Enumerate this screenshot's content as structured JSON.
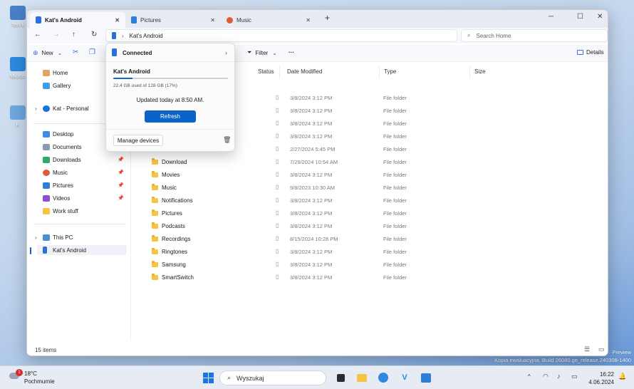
{
  "desktop": {
    "icons": [
      {
        "label": "Ten k"
      },
      {
        "label": "Micros"
      },
      {
        "label": "K"
      }
    ],
    "watermark": {
      "line1": "Preview",
      "line2": "Kopia ewaluacyjna. Build 26080.ge_release.240308-1400"
    }
  },
  "tabs": [
    {
      "label": "Kat's Android",
      "active": true
    },
    {
      "label": "Pictures",
      "active": false
    },
    {
      "label": "Music",
      "active": false
    }
  ],
  "window_controls": {
    "minimize": "─",
    "maximize": "☐",
    "close": "✕"
  },
  "address": {
    "crumb": "Kat's Android",
    "search_placeholder": "Search Home"
  },
  "command_bar": {
    "new_label": "New",
    "filter_label": "Filter",
    "more_label": "···",
    "details_label": "Details"
  },
  "sidebar": {
    "items": [
      {
        "label": "Home"
      },
      {
        "label": "Gallery"
      },
      {
        "label": "Kat - Personal"
      },
      {
        "label": "Desktop"
      },
      {
        "label": "Documents"
      },
      {
        "label": "Downloads"
      },
      {
        "label": "Music"
      },
      {
        "label": "Pictures"
      },
      {
        "label": "Videos"
      },
      {
        "label": "Work stuff"
      },
      {
        "label": "This PC"
      },
      {
        "label": "Kat's Android"
      }
    ]
  },
  "columns": {
    "status": "Status",
    "date": "Date Modified",
    "type": "Type",
    "size": "Size"
  },
  "rows": [
    {
      "name": "",
      "date": "3/8/2024 3:12 PM",
      "type": "File folder"
    },
    {
      "name": "",
      "date": "3/8/2024 3:12 PM",
      "type": "File folder"
    },
    {
      "name": "",
      "date": "3/8/2024 3:12 PM",
      "type": "File folder"
    },
    {
      "name": "",
      "date": "3/8/2024 3:12 PM",
      "type": "File folder"
    },
    {
      "name": "",
      "date": "2/27/2024 5:45 PM",
      "type": "File folder"
    },
    {
      "name": "Download",
      "date": "7/29/2024 10:54 AM",
      "type": "File folder"
    },
    {
      "name": "Movies",
      "date": "3/8/2024 3:12 PM",
      "type": "File folder"
    },
    {
      "name": "Music",
      "date": "9/8/2023 10:30 AM",
      "type": "File folder"
    },
    {
      "name": "Notifications",
      "date": "3/8/2024 3:12 PM",
      "type": "File folder"
    },
    {
      "name": "Pictures",
      "date": "3/8/2024 3:12 PM",
      "type": "File folder"
    },
    {
      "name": "Podcasts",
      "date": "3/8/2024 3:12 PM",
      "type": "File folder"
    },
    {
      "name": "Recordings",
      "date": "8/15/2024 10:28 PM",
      "type": "File folder"
    },
    {
      "name": "Ringtones",
      "date": "3/8/2024 3:12 PM",
      "type": "File folder"
    },
    {
      "name": "Samsung",
      "date": "3/8/2024 3:12 PM",
      "type": "File folder"
    },
    {
      "name": "SmartSwitch",
      "date": "3/8/2024 3:12 PM",
      "type": "File folder"
    }
  ],
  "status_bar": {
    "count": "15 items"
  },
  "flyout": {
    "connected": "Connected",
    "device_name": "Kat's Android",
    "usage": "22.4 GB used of 128 GB (17%)",
    "usage_fraction": 0.17,
    "updated": "Updated today at 8:50 AM.",
    "refresh": "Refresh",
    "manage": "Manage devices"
  },
  "taskbar": {
    "weather_temp": "18°C",
    "weather_desc": "Pochmurnie",
    "weather_badge": "1",
    "search_placeholder": "Wyszukaj",
    "time": "16:22",
    "date": "4.06.2024"
  },
  "colors": {
    "accent": "#0a64c8",
    "folder": "#f6c343"
  }
}
